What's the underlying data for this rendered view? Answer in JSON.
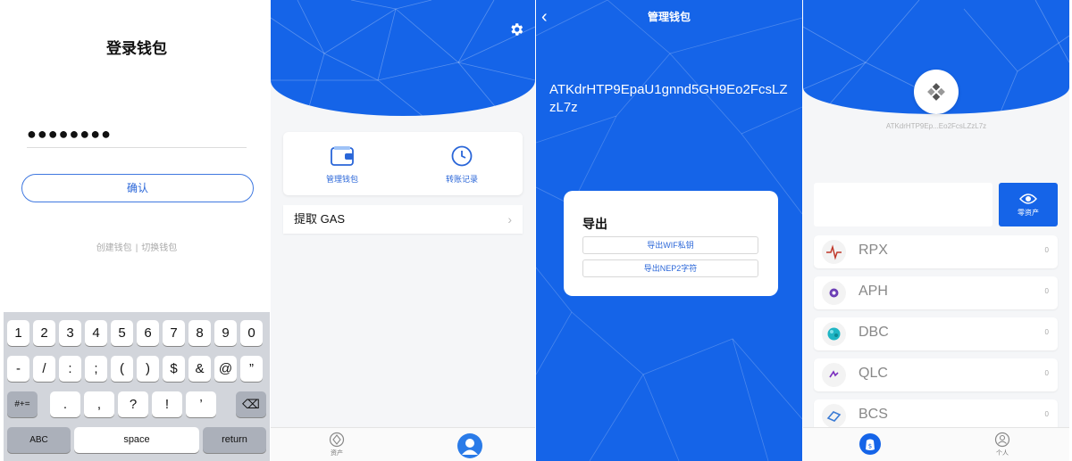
{
  "login": {
    "title": "登录钱包",
    "password_mask": "●●●●●●●●",
    "confirm_label": "确认",
    "create_link": "创建钱包",
    "separator": "|",
    "switch_link": "切换钱包"
  },
  "keyboard": {
    "row1": [
      "1",
      "2",
      "3",
      "4",
      "5",
      "6",
      "7",
      "8",
      "9",
      "0"
    ],
    "row2": [
      "-",
      "/",
      ":",
      ";",
      "(",
      ")",
      "$",
      "&",
      "@",
      "”"
    ],
    "row3": [
      "#+=",
      ".",
      ",",
      "?",
      "!",
      "’",
      "⌫"
    ],
    "row4": [
      "ABC",
      "space",
      "return"
    ]
  },
  "wallet_home": {
    "manage_label": "管理钱包",
    "history_label": "转账记录",
    "gas_label": "提取 GAS",
    "chevron": "›",
    "tab_assets": "资产"
  },
  "manage": {
    "back": "‹",
    "title": "管理钱包",
    "address": "ATKdrHTP9EpaU1gnnd5GH9Eo2FcsLZzL7z",
    "export_title": "导出",
    "export_wif": "导出WIF私钥",
    "export_nep2": "导出NEP2字符"
  },
  "assets": {
    "address_short": "ATKdrHTP9Ep...Eo2FcsLZzL7z",
    "zero_assets_label": "零资产",
    "tokens": [
      {
        "name": "RPX",
        "value": "0"
      },
      {
        "name": "APH",
        "value": "0"
      },
      {
        "name": "DBC",
        "value": "0"
      },
      {
        "name": "QLC",
        "value": "0"
      },
      {
        "name": "BCS",
        "value": "0"
      }
    ],
    "tab_personal": "个人"
  },
  "colors": {
    "brand_blue": "#1564e8",
    "link_blue": "#2a66d8"
  }
}
